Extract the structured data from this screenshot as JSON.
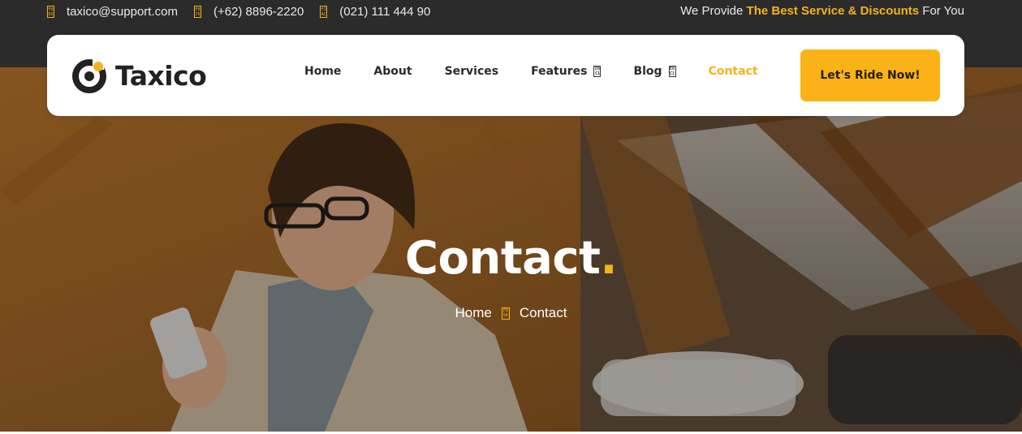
{
  "topbar": {
    "contacts": [
      {
        "icon": "email-icon",
        "text": "taxico@support.com"
      },
      {
        "icon": "phone-icon",
        "text": "(+62) 8896-2220"
      },
      {
        "icon": "phone-icon",
        "text": "(021) 111 444 90"
      }
    ],
    "tagline_prefix": "We Provide ",
    "tagline_highlight": "The Best Service & Discounts",
    "tagline_suffix": " For You"
  },
  "header": {
    "logo_text": "Taxico",
    "nav": [
      {
        "label": "Home",
        "dropdown": false,
        "active": false
      },
      {
        "label": "About",
        "dropdown": false,
        "active": false
      },
      {
        "label": "Services",
        "dropdown": false,
        "active": false
      },
      {
        "label": "Features",
        "dropdown": true,
        "active": false
      },
      {
        "label": "Blog",
        "dropdown": true,
        "active": false
      },
      {
        "label": "Contact",
        "dropdown": false,
        "active": true
      }
    ],
    "cta_label": "Let's Ride Now!"
  },
  "hero": {
    "title": "Contact",
    "title_dot": ".",
    "breadcrumb": [
      {
        "label": "Home"
      },
      {
        "label": "Contact"
      }
    ]
  },
  "colors": {
    "accent": "#f5b21a",
    "topbar_bg": "#2b2b2b",
    "text_dark": "#2a2a2a"
  }
}
